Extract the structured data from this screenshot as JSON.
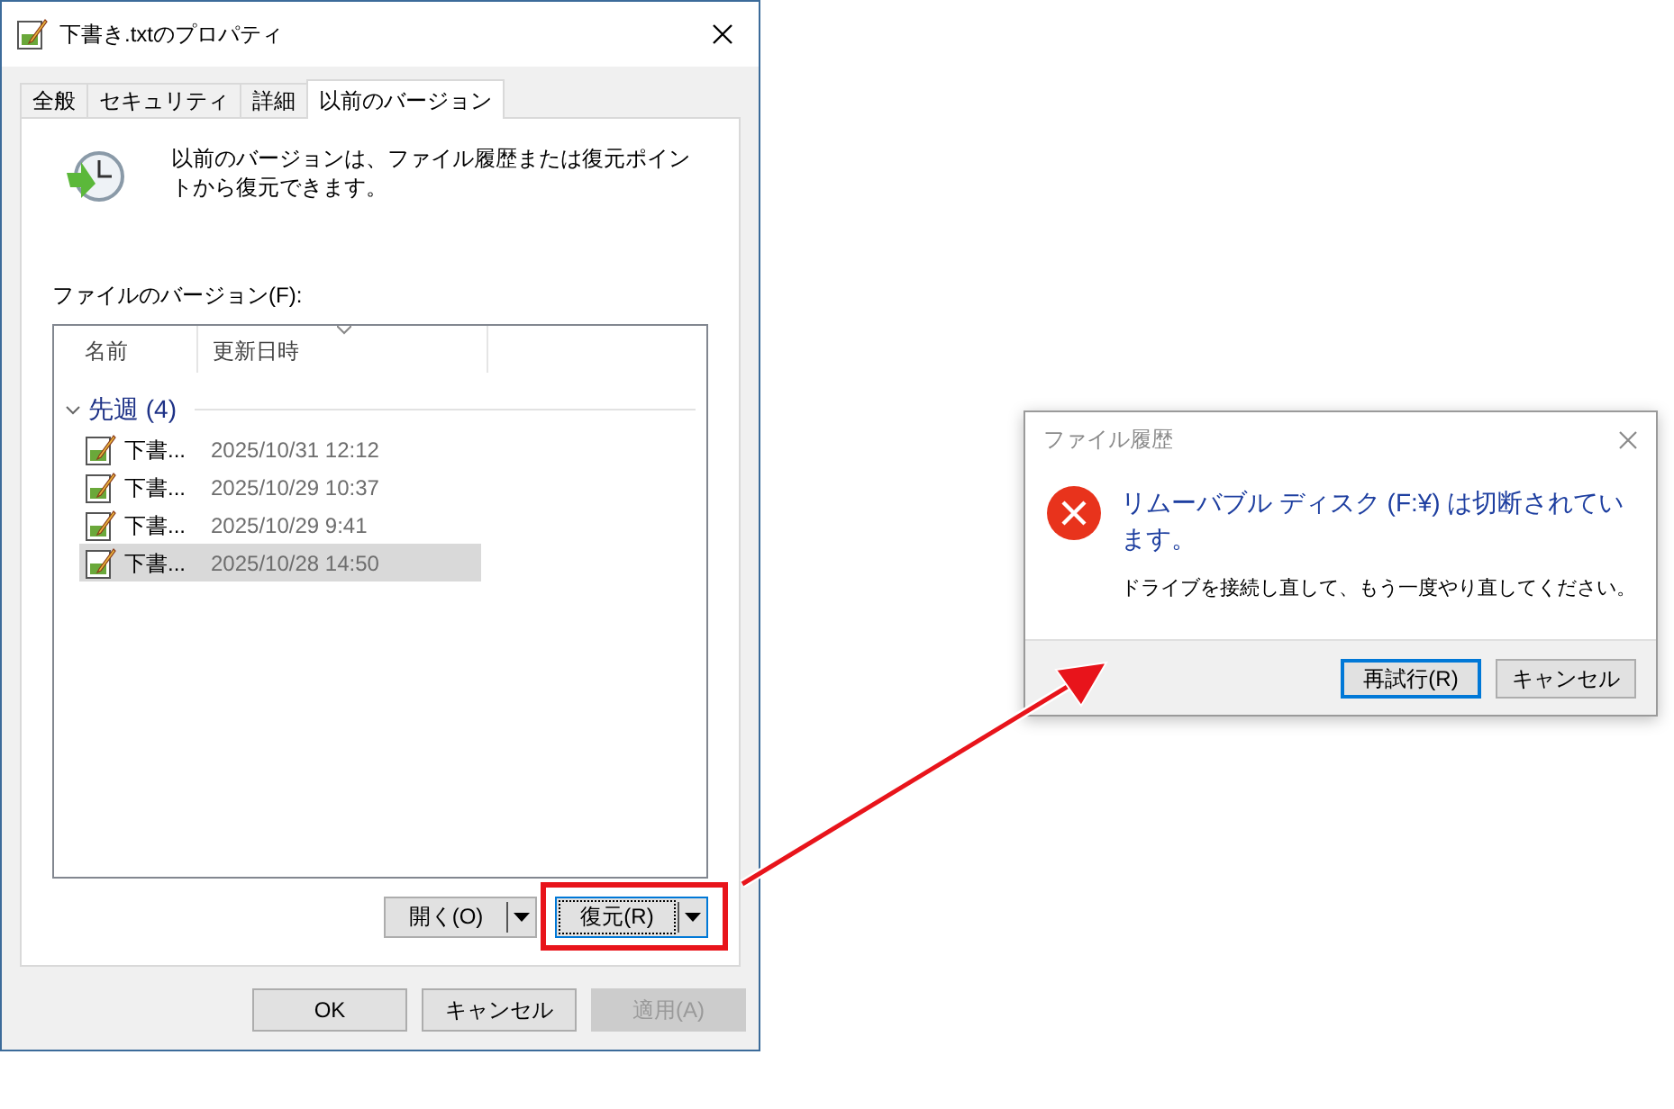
{
  "window": {
    "title": "下書き.txtのプロパティ"
  },
  "tabs": [
    {
      "label": "全般",
      "selected": false
    },
    {
      "label": "セキュリティ",
      "selected": false
    },
    {
      "label": "詳細",
      "selected": false
    },
    {
      "label": "以前のバージョン",
      "selected": true
    }
  ],
  "description": "以前のバージョンは、ファイル履歴または復元ポイントから復元できます。",
  "versions_label": "ファイルのバージョン(F):",
  "list": {
    "columns": [
      "名前",
      "更新日時"
    ],
    "groups": [
      {
        "label": "先週 (4)",
        "expanded": true,
        "items": [
          {
            "name": "下書...",
            "date": "2025/10/31 12:12",
            "selected": false
          },
          {
            "name": "下書...",
            "date": "2025/10/29 10:37",
            "selected": false
          },
          {
            "name": "下書...",
            "date": "2025/10/29 9:41",
            "selected": false
          },
          {
            "name": "下書...",
            "date": "2025/10/28 14:50",
            "selected": true
          }
        ]
      }
    ]
  },
  "split_buttons": [
    {
      "label": "開く(O)",
      "focused": false
    },
    {
      "label": "復元(R)",
      "focused": true
    }
  ],
  "buttons": [
    {
      "label": "OK",
      "disabled": false
    },
    {
      "label": "キャンセル",
      "disabled": false
    },
    {
      "label": "適用(A)",
      "disabled": true
    }
  ],
  "error_dialog": {
    "title": "ファイル履歴",
    "heading": "リムーバブル ディスク (F:¥) は切断されています。",
    "message": "ドライブを接続し直して、もう一度やり直してください。",
    "buttons": [
      {
        "label": "再試行(R)",
        "default": true
      },
      {
        "label": "キャンセル",
        "default": false
      }
    ]
  }
}
